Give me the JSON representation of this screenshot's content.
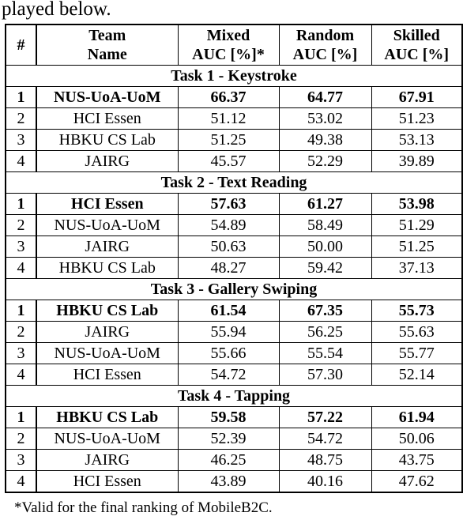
{
  "intro_text": "played below.",
  "table": {
    "headers": [
      {
        "line1": "#",
        "line2": ""
      },
      {
        "line1": "Team",
        "line2": "Name"
      },
      {
        "line1": "Mixed",
        "line2": "AUC [%]*"
      },
      {
        "line1": "Random",
        "line2": "AUC [%]"
      },
      {
        "line1": "Skilled",
        "line2": "AUC [%]"
      }
    ],
    "tasks": [
      {
        "title": "Task 1 - Keystroke",
        "rows": [
          {
            "rank": "1",
            "team": "NUS-UoA-UoM",
            "mixed": "66.37",
            "random": "64.77",
            "skilled": "67.91",
            "winner": true
          },
          {
            "rank": "2",
            "team": "HCI Essen",
            "mixed": "51.12",
            "random": "53.02",
            "skilled": "51.23",
            "winner": false
          },
          {
            "rank": "3",
            "team": "HBKU CS Lab",
            "mixed": "51.25",
            "random": "49.38",
            "skilled": "53.13",
            "winner": false
          },
          {
            "rank": "4",
            "team": "JAIRG",
            "mixed": "45.57",
            "random": "52.29",
            "skilled": "39.89",
            "winner": false
          }
        ]
      },
      {
        "title": "Task 2 - Text Reading",
        "rows": [
          {
            "rank": "1",
            "team": "HCI Essen",
            "mixed": "57.63",
            "random": "61.27",
            "skilled": "53.98",
            "winner": true
          },
          {
            "rank": "2",
            "team": "NUS-UoA-UoM",
            "mixed": "54.89",
            "random": "58.49",
            "skilled": "51.29",
            "winner": false
          },
          {
            "rank": "3",
            "team": "JAIRG",
            "mixed": "50.63",
            "random": "50.00",
            "skilled": "51.25",
            "winner": false
          },
          {
            "rank": "4",
            "team": "HBKU CS Lab",
            "mixed": "48.27",
            "random": "59.42",
            "skilled": "37.13",
            "winner": false
          }
        ]
      },
      {
        "title": "Task 3 - Gallery Swiping",
        "rows": [
          {
            "rank": "1",
            "team": "HBKU CS Lab",
            "mixed": "61.54",
            "random": "67.35",
            "skilled": "55.73",
            "winner": true
          },
          {
            "rank": "2",
            "team": "JAIRG",
            "mixed": "55.94",
            "random": "56.25",
            "skilled": "55.63",
            "winner": false
          },
          {
            "rank": "3",
            "team": "NUS-UoA-UoM",
            "mixed": "55.66",
            "random": "55.54",
            "skilled": "55.77",
            "winner": false
          },
          {
            "rank": "4",
            "team": "HCI Essen",
            "mixed": "54.72",
            "random": "57.30",
            "skilled": "52.14",
            "winner": false
          }
        ]
      },
      {
        "title": "Task 4 - Tapping",
        "rows": [
          {
            "rank": "1",
            "team": "HBKU CS Lab",
            "mixed": "59.58",
            "random": "57.22",
            "skilled": "61.94",
            "winner": true
          },
          {
            "rank": "2",
            "team": "NUS-UoA-UoM",
            "mixed": "52.39",
            "random": "54.72",
            "skilled": "50.06",
            "winner": false
          },
          {
            "rank": "3",
            "team": "JAIRG",
            "mixed": "46.25",
            "random": "48.75",
            "skilled": "43.75",
            "winner": false
          },
          {
            "rank": "4",
            "team": "HCI Essen",
            "mixed": "43.89",
            "random": "40.16",
            "skilled": "47.62",
            "winner": false
          }
        ]
      }
    ]
  },
  "footnote": "*Valid for the final ranking of MobileB2C."
}
